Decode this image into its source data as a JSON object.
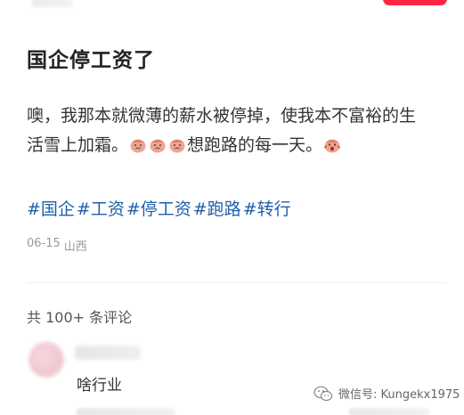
{
  "post": {
    "title": "国企停工资了",
    "body_part1": "噢，我那本就微薄的薪水被停掉，使我本不富裕的生活雪上加霜。",
    "body_part2": "想跑路的每一天。",
    "emoji_icons": [
      "crying-face-icon",
      "crying-face-icon",
      "crying-face-icon",
      "screaming-face-icon"
    ],
    "tags": [
      "#国企",
      "#工资",
      "#停工资",
      "#跑路",
      "#转行"
    ],
    "date": "06-15",
    "location": "山西"
  },
  "comments": {
    "count_label": "共 100+ 条评论",
    "items": [
      {
        "text": "啥行业"
      }
    ]
  },
  "watermark": {
    "text": "微信号: Kungekx1975",
    "icon": "wechat-icon"
  },
  "colors": {
    "tag_blue": "#1f5fa8",
    "accent_red": "#ff2442"
  }
}
